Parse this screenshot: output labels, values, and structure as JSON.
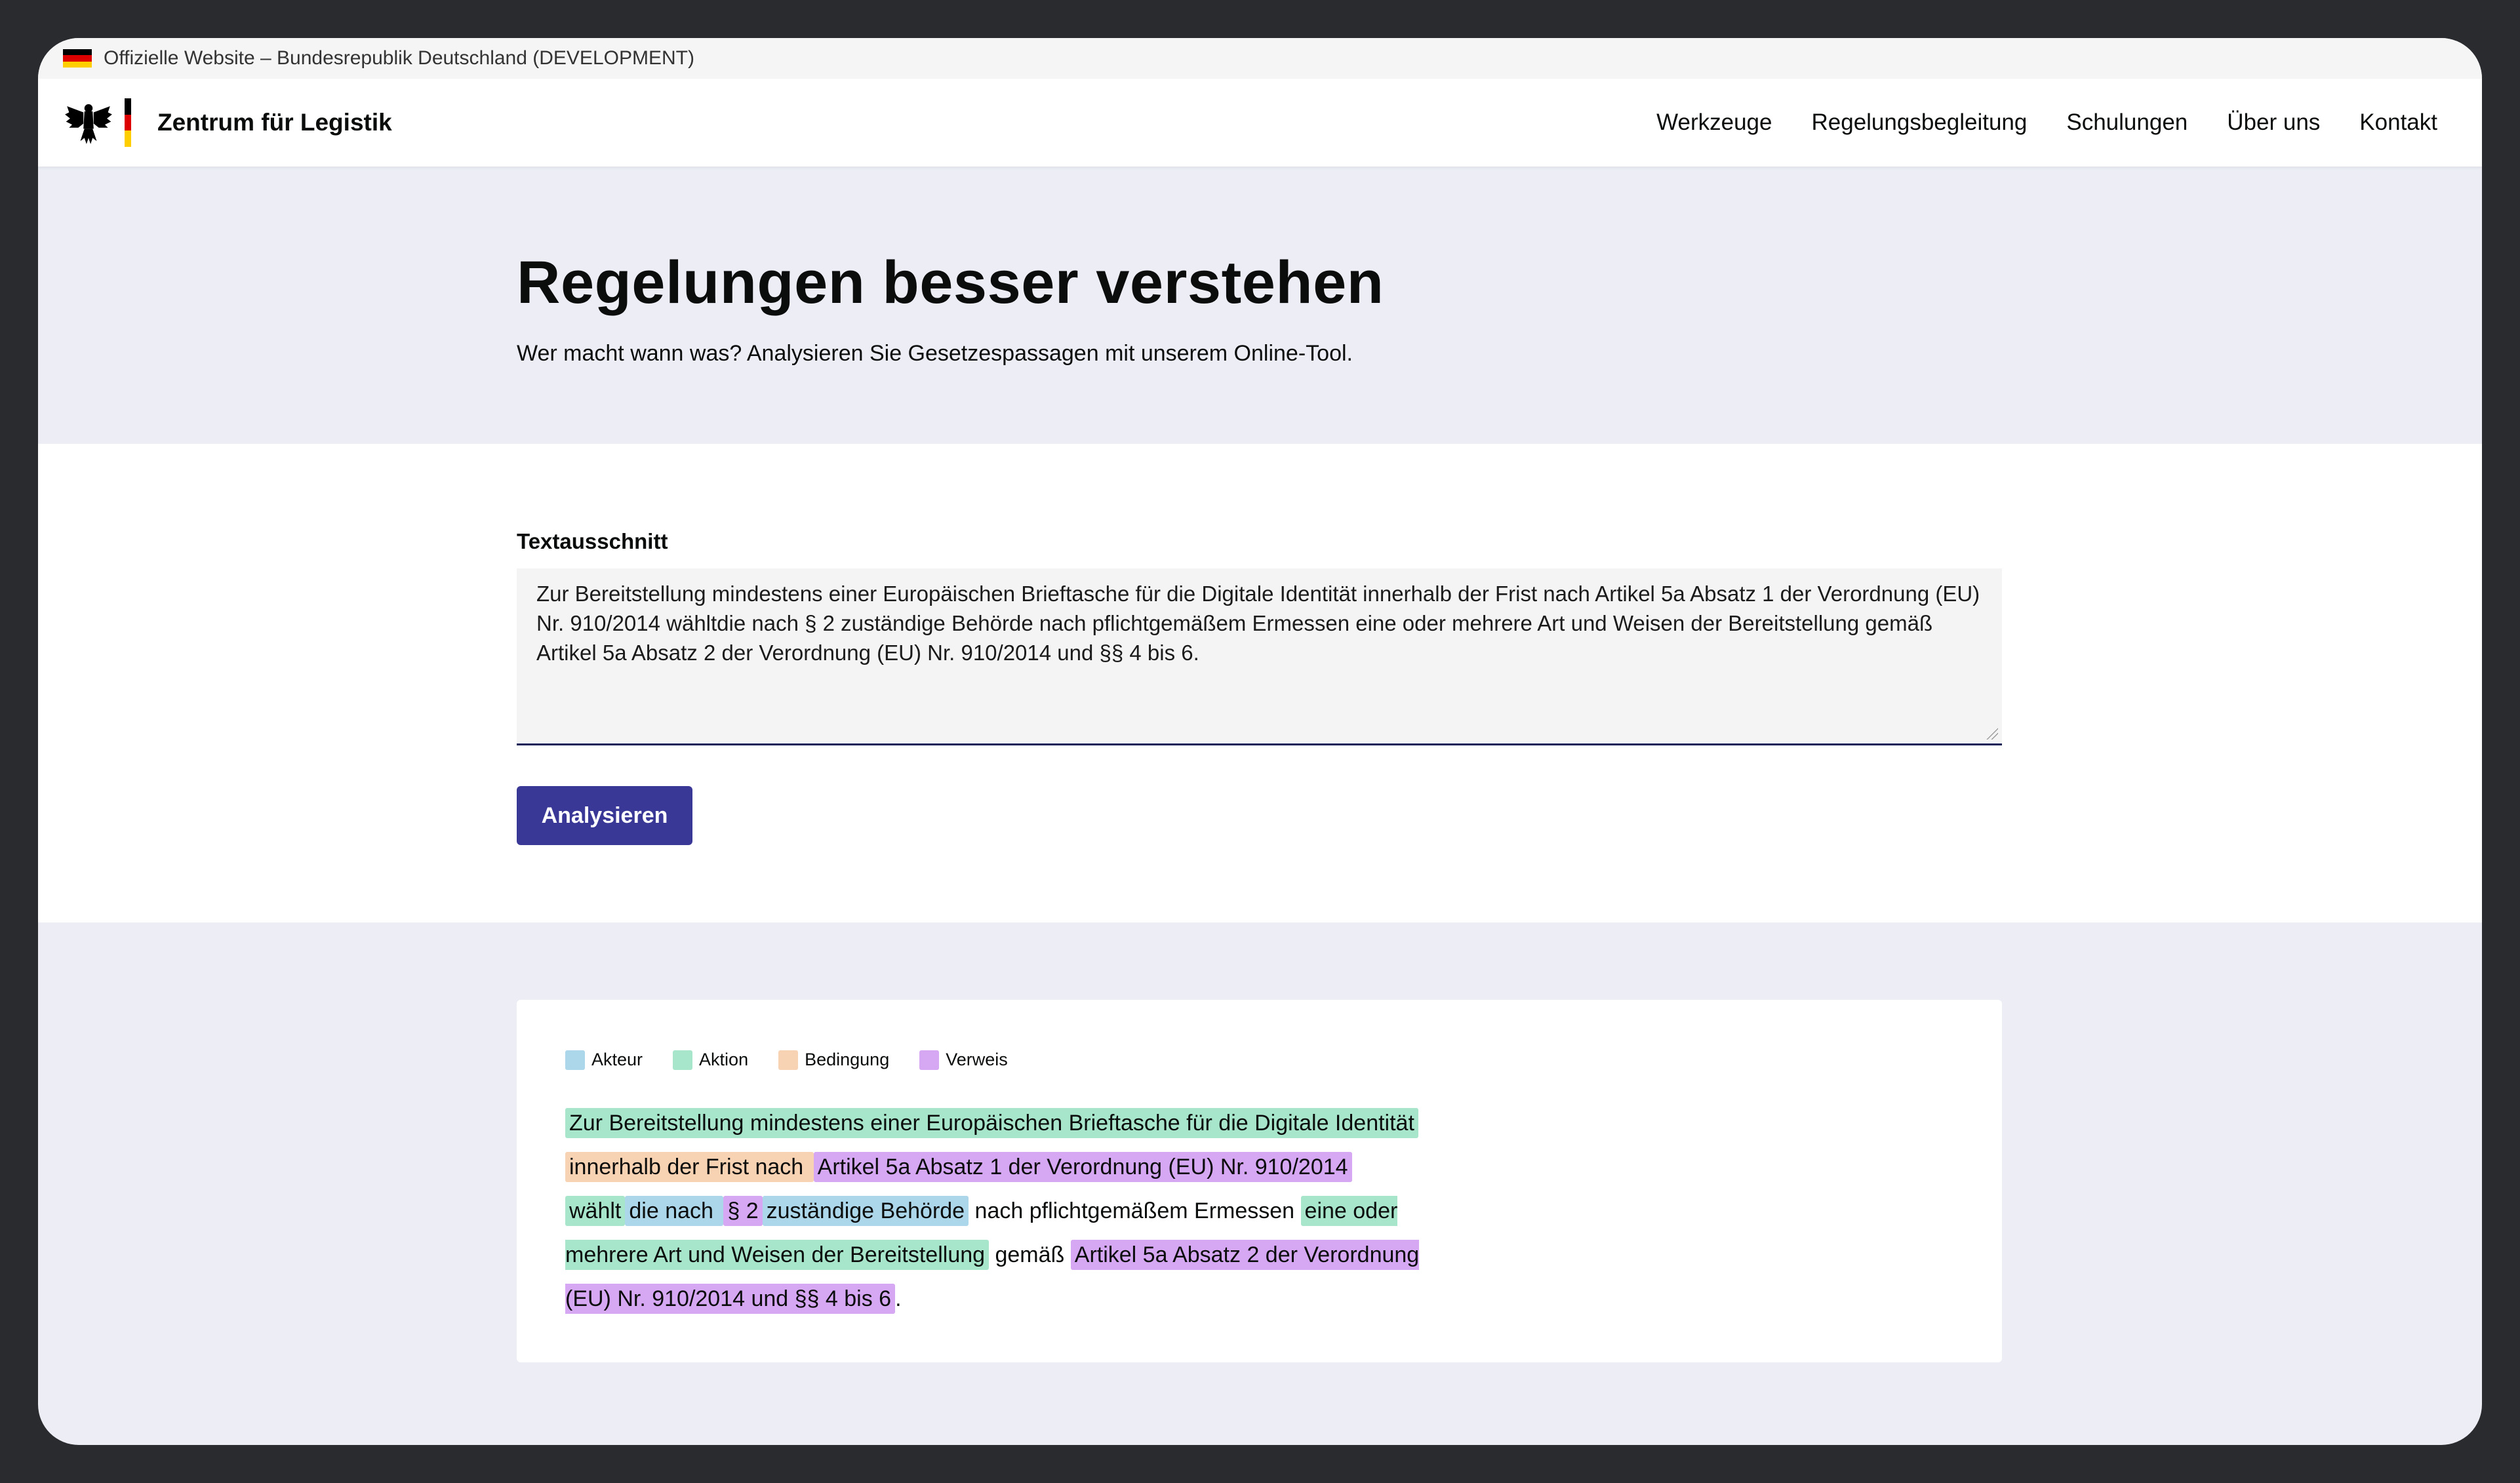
{
  "banner": {
    "text": "Offizielle Website – Bundesrepublik Deutschland (DEVELOPMENT)"
  },
  "header": {
    "site_title": "Zentrum für Legistik",
    "nav": [
      "Werkzeuge",
      "Regelungsbegleitung",
      "Schulungen",
      "Über uns",
      "Kontakt"
    ]
  },
  "hero": {
    "title": "Regelungen besser verstehen",
    "subtitle": "Wer macht wann was? Analysieren Sie Gesetzespassagen mit unserem Online-Tool."
  },
  "form": {
    "label": "Textausschnitt",
    "value": "Zur Bereitstellung mindestens einer Europäischen Brieftasche für die Digitale Identität innerhalb der Frist nach Artikel 5a Absatz 1 der Verordnung (EU) Nr. 910/2014 wähltdie nach § 2 zuständige Behörde nach pflichtgemäßem Ermessen eine oder mehrere Art und Weisen der Bereitstellung gemäß Artikel 5a Absatz 2 der Verordnung (EU) Nr. 910/2014 und §§ 4 bis 6.",
    "button": "Analysieren"
  },
  "legend": [
    {
      "label": "Akteur",
      "color": "#acd6ea"
    },
    {
      "label": "Aktion",
      "color": "#a8e6cc"
    },
    {
      "label": "Bedingung",
      "color": "#f7d2b3"
    },
    {
      "label": "Verweis",
      "color": "#d6a7f2"
    }
  ],
  "analysis": [
    {
      "text": "Zur Bereitstellung mindestens einer Europäischen Brieftasche für die Digitale Identität",
      "type": "aktion"
    },
    {
      "text": " ",
      "type": "plain"
    },
    {
      "text": "innerhalb der Frist nach ",
      "type": "bedingung"
    },
    {
      "text": "Artikel 5a Absatz 1 der Verordnung (EU) Nr. 910/2014",
      "type": "verweis"
    },
    {
      "text": " ",
      "type": "plain"
    },
    {
      "text": "wählt",
      "type": "aktion"
    },
    {
      "text": "die nach ",
      "type": "akteur"
    },
    {
      "text": "§ 2",
      "type": "verweis"
    },
    {
      "text": "zuständige Behörde",
      "type": "akteur"
    },
    {
      "text": " nach pflichtgemäßem Ermessen ",
      "type": "plain"
    },
    {
      "text": "eine oder mehrere Art und Weisen der Bereitstellung",
      "type": "aktion"
    },
    {
      "text": " gemäß ",
      "type": "plain"
    },
    {
      "text": "Artikel 5a Absatz 2 der Verordnung (EU) Nr. 910/2014 und §§ 4 bis 6",
      "type": "verweis"
    },
    {
      "text": ".",
      "type": "plain"
    }
  ]
}
